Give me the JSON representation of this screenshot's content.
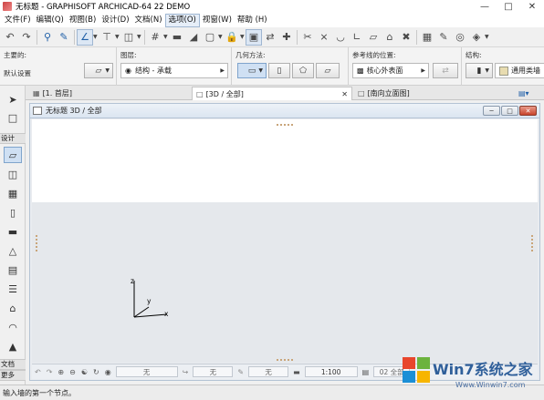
{
  "window": {
    "title": "无标题 - GRAPHISOFT ARCHICAD-64 22 DEMO",
    "controls": [
      "minimize",
      "maximize",
      "close"
    ]
  },
  "menu": {
    "items": [
      "文件(F)",
      "编辑(Q)",
      "视图(B)",
      "设计(D)",
      "文档(N)",
      "选项(O)",
      "视窗(W)",
      "帮助 (H)"
    ],
    "active_index": 5
  },
  "infobox": {
    "main_label": "主要的:",
    "main_sub": "默认设置",
    "layer_label": "图层:",
    "layer_value": "结构 - 承载",
    "geometry_label": "几何方法:",
    "ref_label": "参考线的位置:",
    "ref_value": "核心外表面",
    "structure_label": "结构:",
    "structure_value": "通用类墙"
  },
  "toolbox": {
    "design_label": "设计",
    "doc_label": "文档",
    "more_label": "更多"
  },
  "tabs": [
    {
      "label": "[1. 首层]",
      "active": false
    },
    {
      "label": "[3D / 全部]",
      "active": true
    },
    {
      "label": "[南向立面图]",
      "active": false
    }
  ],
  "view3d": {
    "title": "无标题 3D / 全部",
    "axes": {
      "z": "z",
      "y": "y",
      "x": "x"
    }
  },
  "viewbar": {
    "none1": "无",
    "none2": "无",
    "none3": "无",
    "scale": "1:100",
    "partial": "02 全部"
  },
  "status": {
    "text": "输入墙的第一个节点。"
  },
  "watermark": {
    "brand": "Win7系统之家",
    "url": "Www.Winwin7.com"
  },
  "colors": {
    "accent": "#1f5fa8",
    "selected": "#cfe0f3",
    "ground": "#e5e8ec"
  }
}
